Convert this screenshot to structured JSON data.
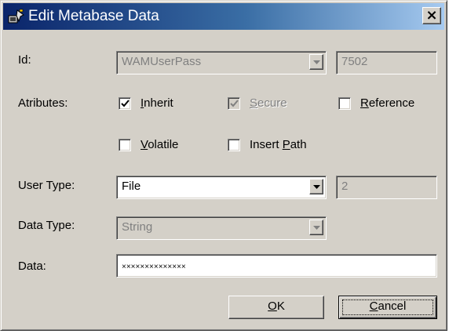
{
  "window": {
    "title": "Edit Metabase Data",
    "icon": "metabase-tool-icon",
    "close_label": "×"
  },
  "labels": {
    "id": "Id:",
    "attributes": "Atributes:",
    "user_type": "User Type:",
    "data_type": "Data Type:",
    "data": "Data:"
  },
  "fields": {
    "id_name": "WAMUserPass",
    "id_number": "7502",
    "user_type": "File",
    "user_type_number": "2",
    "data_type": "String",
    "data_value": "××××××××××××××"
  },
  "checkboxes": {
    "inherit": {
      "before": "",
      "mnemonic": "I",
      "after": "nherit",
      "checked": true,
      "enabled": true
    },
    "secure": {
      "before": "",
      "mnemonic": "S",
      "after": "ecure",
      "checked": true,
      "enabled": false
    },
    "reference": {
      "before": "",
      "mnemonic": "R",
      "after": "eference",
      "checked": false,
      "enabled": true
    },
    "volatile": {
      "before": "",
      "mnemonic": "V",
      "after": "olatile",
      "checked": false,
      "enabled": true
    },
    "insert_path": {
      "before": "Insert ",
      "mnemonic": "P",
      "after": "ath",
      "checked": false,
      "enabled": true
    }
  },
  "buttons": {
    "ok": {
      "mnemonic": "O",
      "after": "K"
    },
    "cancel": {
      "mnemonic": "C",
      "after": "ancel"
    }
  },
  "colors": {
    "dialog_face": "#d4d0c8",
    "title_start": "#0a246a",
    "title_end": "#a6caf0",
    "disabled_text": "#808080"
  }
}
